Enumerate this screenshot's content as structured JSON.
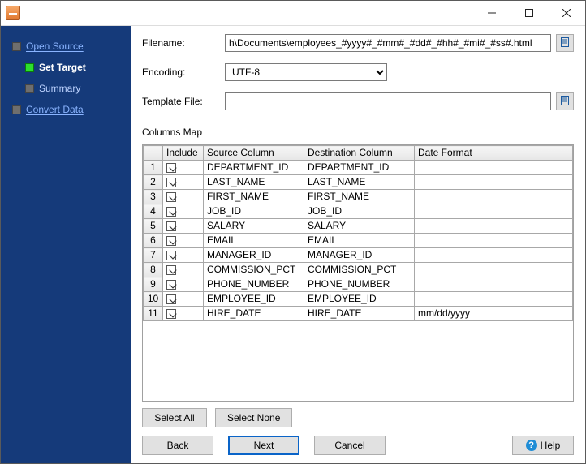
{
  "titlebar": {
    "title": ""
  },
  "sidebar": {
    "items": [
      {
        "label": "Open Source",
        "state": "link",
        "indent": false
      },
      {
        "label": "Set Target",
        "state": "current",
        "indent": true
      },
      {
        "label": "Summary",
        "state": "plain",
        "indent": true
      },
      {
        "label": "Convert Data",
        "state": "link",
        "indent": false
      }
    ]
  },
  "form": {
    "filename_label": "Filename:",
    "filename_value": "h\\Documents\\employees_#yyyy#_#mm#_#dd#_#hh#_#mi#_#ss#.html",
    "encoding_label": "Encoding:",
    "encoding_value": "UTF-8",
    "template_label": "Template File:",
    "template_value": "",
    "columns_map_label": "Columns Map"
  },
  "table": {
    "headers": [
      "",
      "Include",
      "Source Column",
      "Destination Column",
      "Date Format"
    ],
    "rows": [
      {
        "n": "1",
        "include": true,
        "src": "DEPARTMENT_ID",
        "dst": "DEPARTMENT_ID",
        "fmt": ""
      },
      {
        "n": "2",
        "include": true,
        "src": "LAST_NAME",
        "dst": "LAST_NAME",
        "fmt": ""
      },
      {
        "n": "3",
        "include": true,
        "src": "FIRST_NAME",
        "dst": "FIRST_NAME",
        "fmt": ""
      },
      {
        "n": "4",
        "include": true,
        "src": "JOB_ID",
        "dst": "JOB_ID",
        "fmt": ""
      },
      {
        "n": "5",
        "include": true,
        "src": "SALARY",
        "dst": "SALARY",
        "fmt": ""
      },
      {
        "n": "6",
        "include": true,
        "src": "EMAIL",
        "dst": "EMAIL",
        "fmt": ""
      },
      {
        "n": "7",
        "include": true,
        "src": "MANAGER_ID",
        "dst": "MANAGER_ID",
        "fmt": ""
      },
      {
        "n": "8",
        "include": true,
        "src": "COMMISSION_PCT",
        "dst": "COMMISSION_PCT",
        "fmt": ""
      },
      {
        "n": "9",
        "include": true,
        "src": "PHONE_NUMBER",
        "dst": "PHONE_NUMBER",
        "fmt": ""
      },
      {
        "n": "10",
        "include": true,
        "src": "EMPLOYEE_ID",
        "dst": "EMPLOYEE_ID",
        "fmt": ""
      },
      {
        "n": "11",
        "include": true,
        "src": "HIRE_DATE",
        "dst": "HIRE_DATE",
        "fmt": "mm/dd/yyyy"
      }
    ]
  },
  "buttons": {
    "select_all": "Select All",
    "select_none": "Select None",
    "back": "Back",
    "next": "Next",
    "cancel": "Cancel",
    "help": "Help"
  }
}
